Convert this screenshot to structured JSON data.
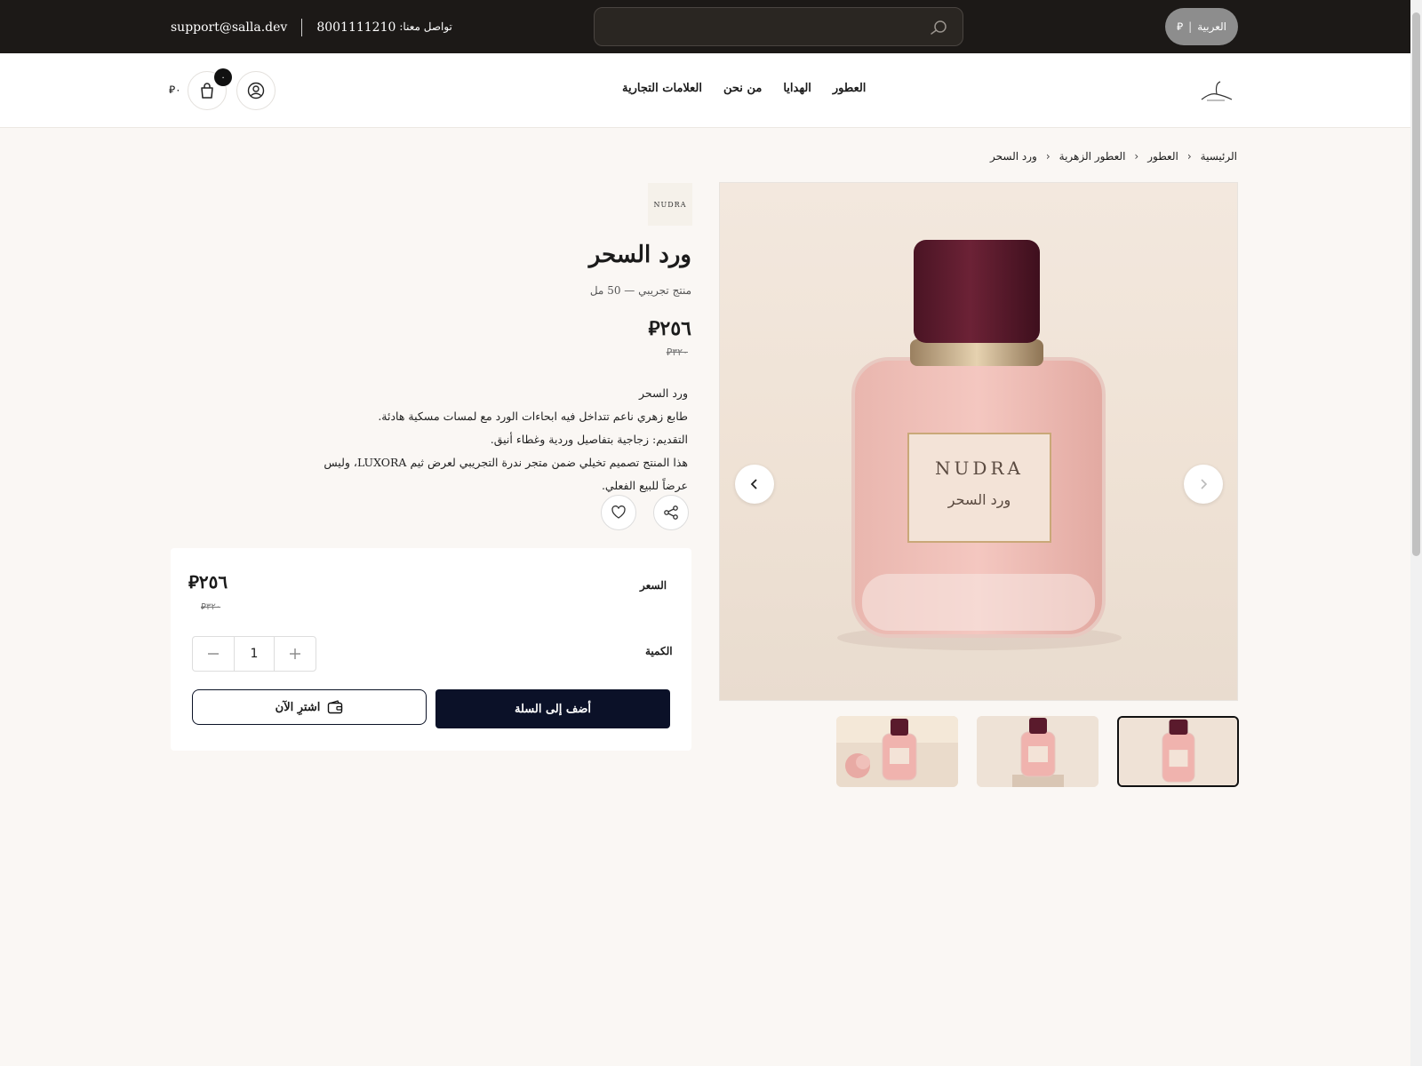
{
  "topbar": {
    "lang_label": "العربية",
    "currency_symbol": "⃁",
    "search_placeholder": "",
    "email": "support@salla.dev",
    "phone_label": "تواصل معنا:",
    "phone": "8001111210"
  },
  "nav": {
    "items": [
      {
        "label": "العطور"
      },
      {
        "label": "الهدايا"
      },
      {
        "label": "من نحن"
      },
      {
        "label": "العلامات التجارية"
      }
    ]
  },
  "cart": {
    "count": "٠",
    "total": "٠"
  },
  "breadcrumb": {
    "items": [
      {
        "label": "الرئيسية"
      },
      {
        "label": "العطور"
      },
      {
        "label": "العطور الزهرية"
      },
      {
        "label": "ورد السحر"
      }
    ]
  },
  "product": {
    "brand": "NUDRA",
    "title": "ورد السحر",
    "subtitle": "منتج تجريبي — 50 مل",
    "price": "٢٥٦",
    "old_price": "٣٢٠",
    "description": [
      "ورد السحر",
      "طابع زهري ناعم تتداخل فيه ابحاءات الورد مع لمسات مسكية هادئة.",
      "التقديم: زجاجية بتفاصيل وردية وغطاء أنيق.",
      "هذا المنتج تصميم تخيلي ضمن متجر ندرة التجريبي لعرض ثيم LUXORA، وليس عرضاً للبيع الفعلي."
    ],
    "bottle_brand": "NUDRA",
    "bottle_label": "ورد السحر"
  },
  "purchase": {
    "price_label": "السعر",
    "qty_label": "الكمية",
    "qty": "1",
    "add_to_cart": "أضف إلى السلة",
    "buy_now": "اشترِ الآن"
  },
  "colors": {
    "topbar": "#1c1917",
    "accent": "#0b1128",
    "cap": "#5a1a2c",
    "liquid": "#f0b3ae"
  }
}
